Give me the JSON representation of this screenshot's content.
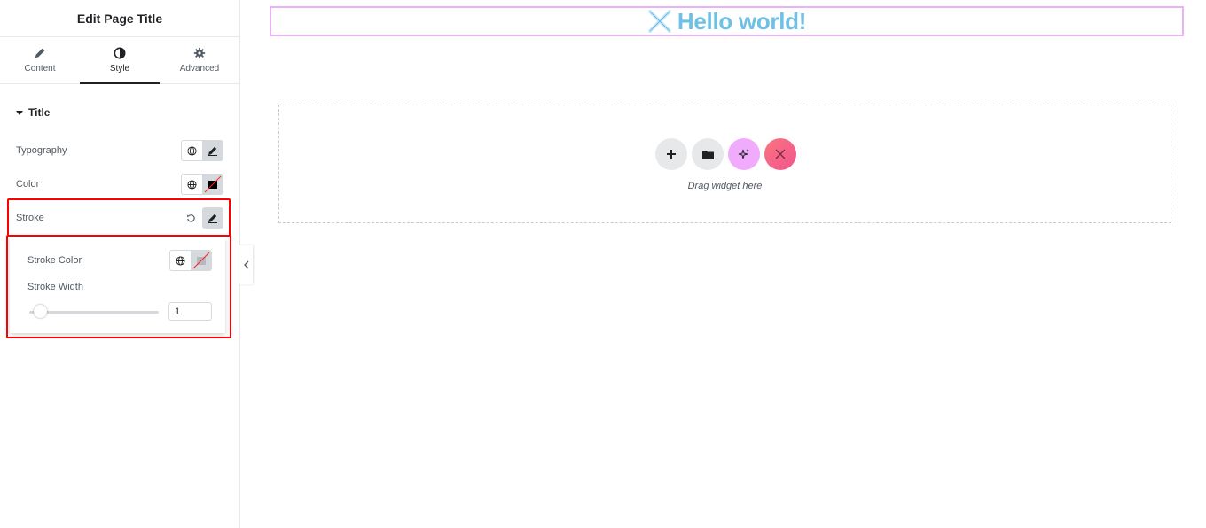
{
  "panel": {
    "title": "Edit Page Title",
    "tabs": [
      {
        "label": "Content",
        "icon": "pencil-icon"
      },
      {
        "label": "Style",
        "icon": "half-circle-icon"
      },
      {
        "label": "Advanced",
        "icon": "gear-icon"
      }
    ],
    "active_tab": "Style",
    "section_title": "Title",
    "controls": {
      "typography_label": "Typography",
      "color_label": "Color",
      "stroke_label": "Stroke"
    },
    "stroke_popover": {
      "stroke_color_label": "Stroke Color",
      "stroke_width_label": "Stroke Width",
      "stroke_width_value": "1"
    }
  },
  "canvas": {
    "heading_text": "Hello world!",
    "drag_text": "Drag widget here"
  },
  "colors": {
    "heading": "#6ec1e4",
    "highlight": "#ff0000",
    "ai_button": "#f0abfc",
    "brand_button": "#f75b8b"
  }
}
